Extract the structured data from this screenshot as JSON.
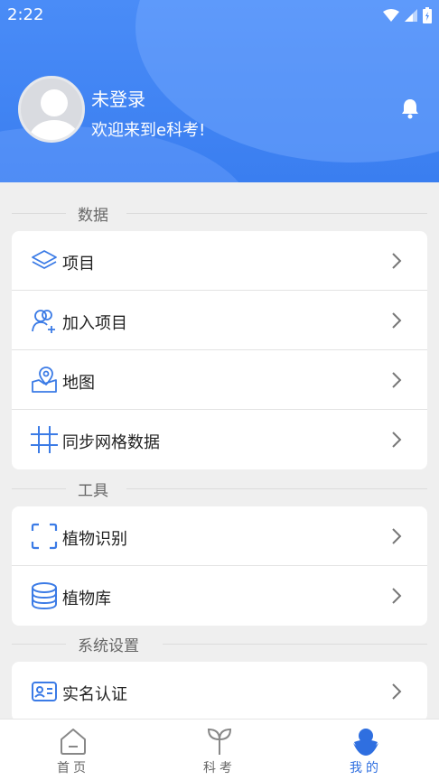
{
  "status_bar": {
    "time": "2:22"
  },
  "profile": {
    "name": "未登录",
    "welcome": "欢迎来到e科考!"
  },
  "sections": {
    "data": {
      "title": "数据",
      "items": [
        {
          "label": "项目"
        },
        {
          "label": "加入项目"
        },
        {
          "label": "地图"
        },
        {
          "label": "同步网格数据"
        }
      ]
    },
    "tools": {
      "title": "工具",
      "items": [
        {
          "label": "植物识别"
        },
        {
          "label": "植物库"
        }
      ]
    },
    "settings": {
      "title": "系统设置",
      "items": [
        {
          "label": "实名认证"
        }
      ]
    }
  },
  "tabbar": {
    "tabs": [
      {
        "label": "首页"
      },
      {
        "label": "科考"
      },
      {
        "label": "我的"
      }
    ],
    "active": "我的"
  },
  "colors": {
    "accent": "#3a7ef0",
    "icon": "#3b7be6"
  }
}
